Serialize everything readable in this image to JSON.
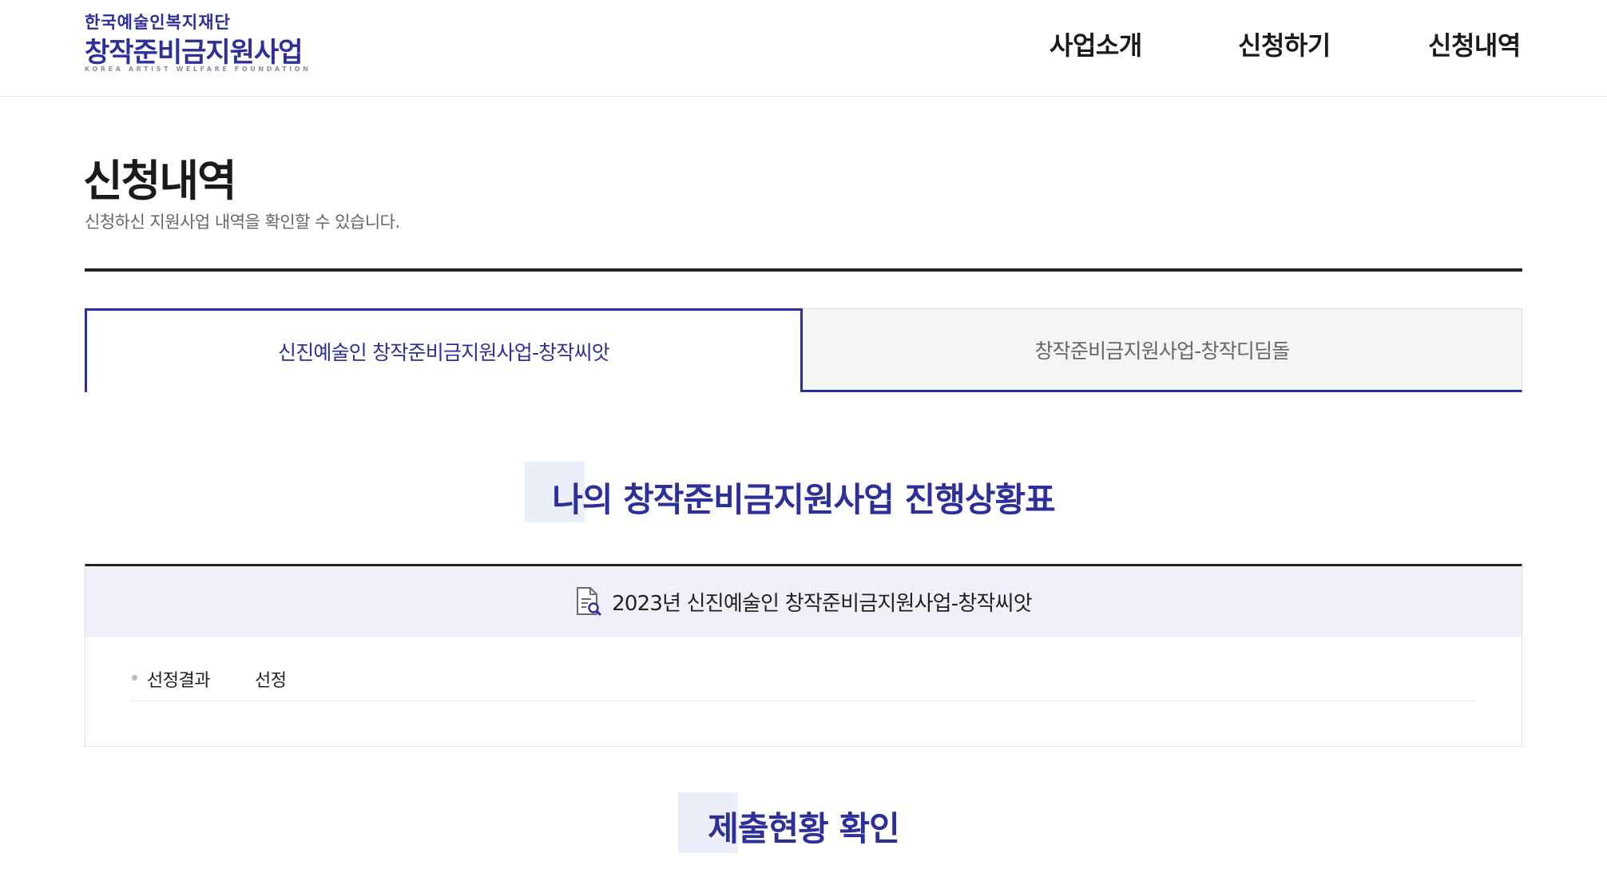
{
  "header": {
    "logo": {
      "org_name": "한국예술인복지재단",
      "program_name": "창작준비금지원사업",
      "english_name": "KOREA ARTIST WELFARE FOUNDATION"
    },
    "nav": [
      {
        "label": "사업소개"
      },
      {
        "label": "신청하기"
      },
      {
        "label": "신청내역"
      }
    ]
  },
  "page": {
    "title": "신청내역",
    "description": "신청하신 지원사업 내역을 확인할 수 있습니다."
  },
  "tabs": [
    {
      "label": "신진예술인 창작준비금지원사업-창작씨앗",
      "active": true
    },
    {
      "label": "창작준비금지원사업-창작디딤돌",
      "active": false
    }
  ],
  "progress_section": {
    "heading": "나의 창작준비금지원사업 진행상황표",
    "card": {
      "title": "2023년 신진예술인 창작준비금지원사업-창작씨앗",
      "icon": "document-search-icon",
      "rows": [
        {
          "label": "선정결과",
          "value": "선정"
        }
      ]
    }
  },
  "submission_section": {
    "heading": "제출현황 확인"
  },
  "colors": {
    "brand": "#2d2f9a",
    "card_header_bg": "#eff0f9",
    "heading_deco": "#eceefa"
  }
}
